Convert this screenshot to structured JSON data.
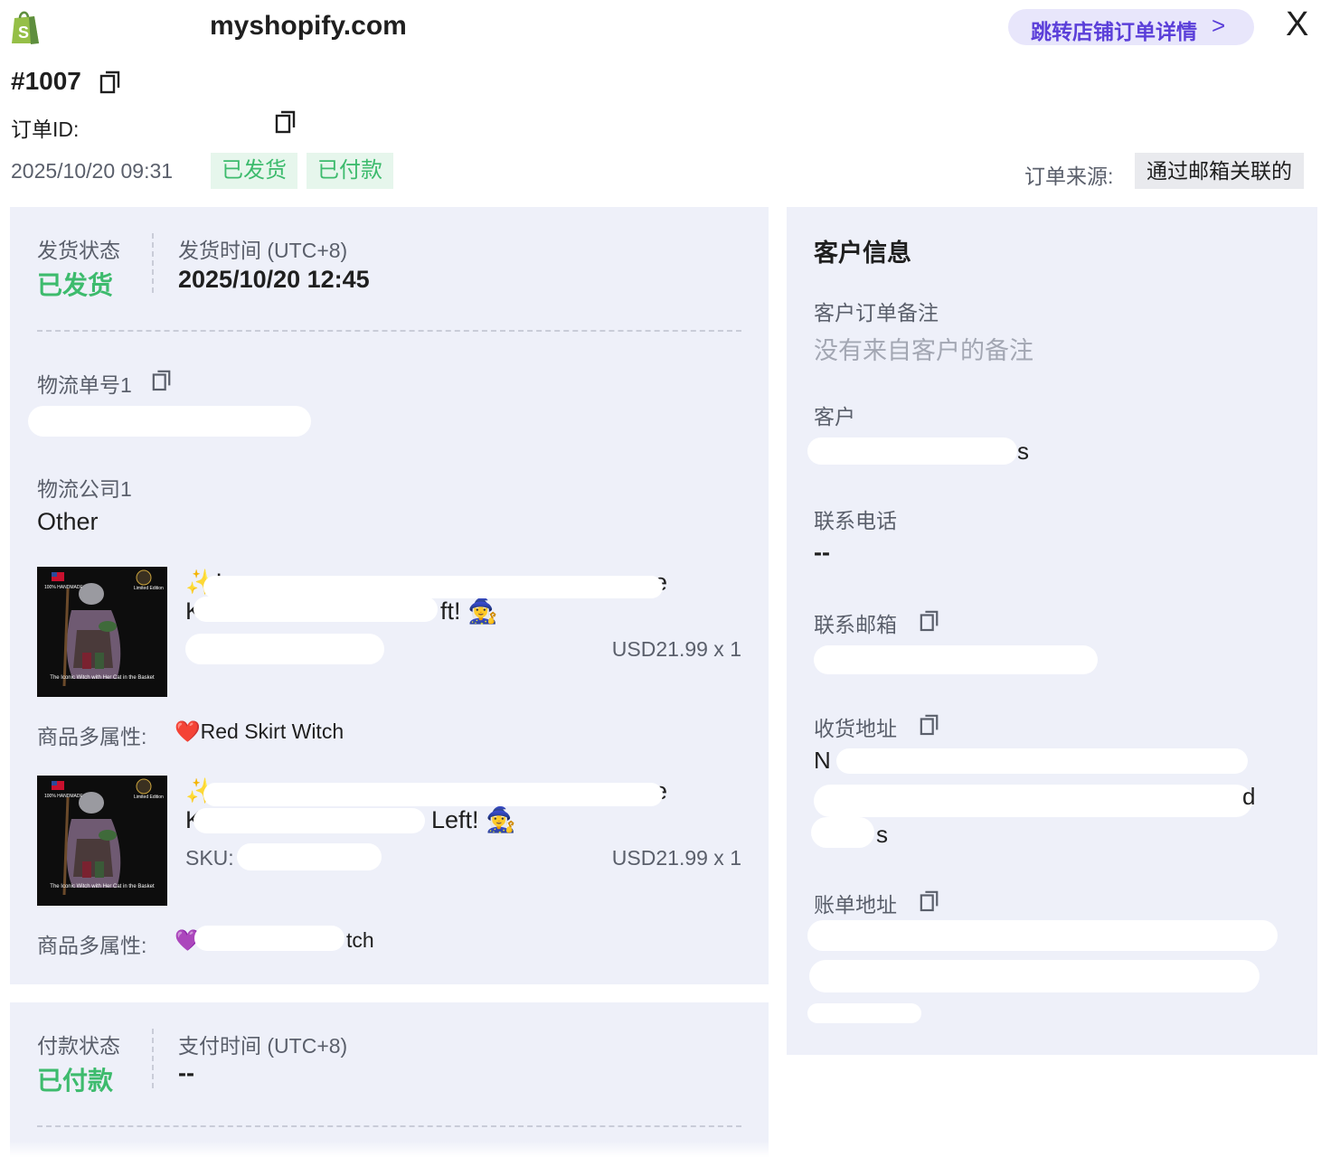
{
  "header": {
    "shop_domain": "myshopify.com",
    "store_link_button": "跳转店铺订单详情",
    "store_link_chevron": ">",
    "close_symbol": "X"
  },
  "order": {
    "number": "#1007",
    "id_label": "订单ID:",
    "datetime": "2025/10/20 09:31",
    "tags": [
      "已发货",
      "已付款"
    ],
    "source_label": "订单来源:",
    "source_value": "通过邮箱关联的"
  },
  "shipping": {
    "status_label": "发货状态",
    "status_value": "已发货",
    "time_label": "发货时间 (UTC+8)",
    "time_value": "2025/10/20 12:45",
    "tracking_label": "物流单号1",
    "carrier_label": "物流公司1",
    "carrier_value": "Other"
  },
  "products": [
    {
      "title_start": "✨L",
      "title_end": "e",
      "title_line2_start": "K",
      "title_line2_end": "ft! 🧙‍♀️",
      "sku_label": "",
      "price": "USD21.99 x 1",
      "attr_label": "商品多属性:",
      "attr_value": "❤️Red Skirt Witch",
      "thumb_top_text": "100% HANDMADE",
      "thumb_badge_text": "Limited Edition",
      "thumb_caption": "The Iconic Witch with Her Cat in the Basket"
    },
    {
      "title_start": "✨",
      "title_end": "e",
      "title_line2_start": "K",
      "title_line2_end": "Left! 🧙‍♀️",
      "sku_label": "SKU:",
      "price": "USD21.99 x 1",
      "attr_label": "商品多属性:",
      "attr_value_start": "💜",
      "attr_value_end": "tch",
      "thumb_top_text": "100% HANDMADE",
      "thumb_badge_text": "Limited Edition",
      "thumb_caption": "The Iconic Witch with Her Cat in the Basket"
    }
  ],
  "payment": {
    "status_label": "付款状态",
    "status_value": "已付款",
    "time_label": "支付时间 (UTC+8)",
    "time_value": "--"
  },
  "customer": {
    "section_title": "客户信息",
    "note_label": "客户订单备注",
    "note_value": "没有来自客户的备注",
    "customer_label": "客户",
    "customer_tail": "s",
    "phone_label": "联系电话",
    "phone_value": "--",
    "email_label": "联系邮箱",
    "shipping_address_label": "收货地址",
    "shipping_address_line1_start": "N",
    "shipping_address_line2_end": "d",
    "shipping_address_line3_end": "s",
    "billing_address_label": "账单地址"
  },
  "colors": {
    "accent_green": "#3dbb6d",
    "panel_bg": "#eef0f9",
    "link_button_bg": "#e8e6fb",
    "link_button_text": "#5b3fd9"
  }
}
